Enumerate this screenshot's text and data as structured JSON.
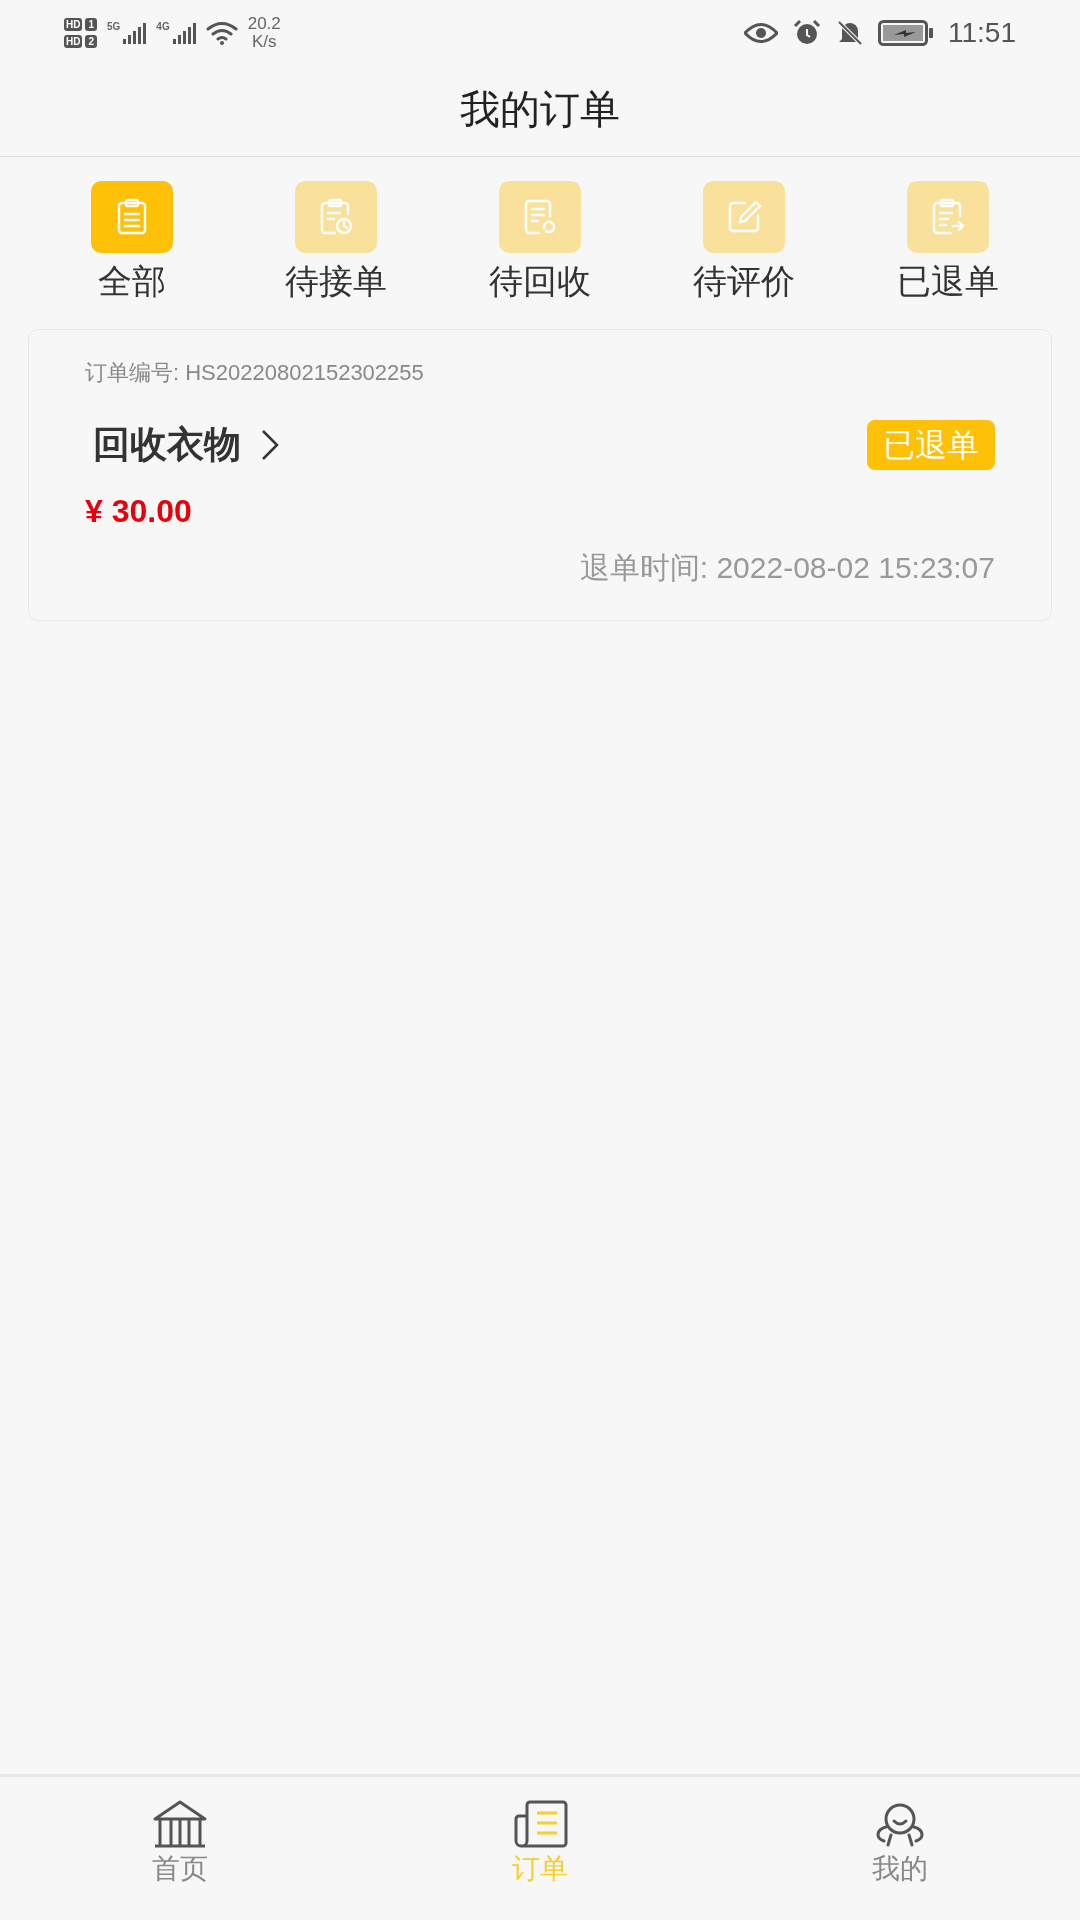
{
  "status_bar": {
    "sim_badges": [
      {
        "label": "HD",
        "slot": "1"
      },
      {
        "label": "HD",
        "slot": "2"
      }
    ],
    "networks": [
      "5G",
      "4G"
    ],
    "speed": "20.2",
    "speed_unit": "K/s",
    "time": "11:51"
  },
  "header": {
    "title": "我的订单"
  },
  "tabs": [
    {
      "label": "全部",
      "selected": true
    },
    {
      "label": "待接单",
      "selected": false
    },
    {
      "label": "待回收",
      "selected": false
    },
    {
      "label": "待评价",
      "selected": false
    },
    {
      "label": "已退单",
      "selected": false
    }
  ],
  "orders": [
    {
      "number": "订单编号: HS20220802152302255",
      "title": "回收衣物",
      "status": "已退单",
      "price": "¥ 30.00",
      "time": "退单时间: 2022-08-02 15:23:07"
    }
  ],
  "bottom_nav": [
    {
      "label": "首页",
      "selected": false
    },
    {
      "label": "订单",
      "selected": true
    },
    {
      "label": "我的",
      "selected": false
    }
  ]
}
